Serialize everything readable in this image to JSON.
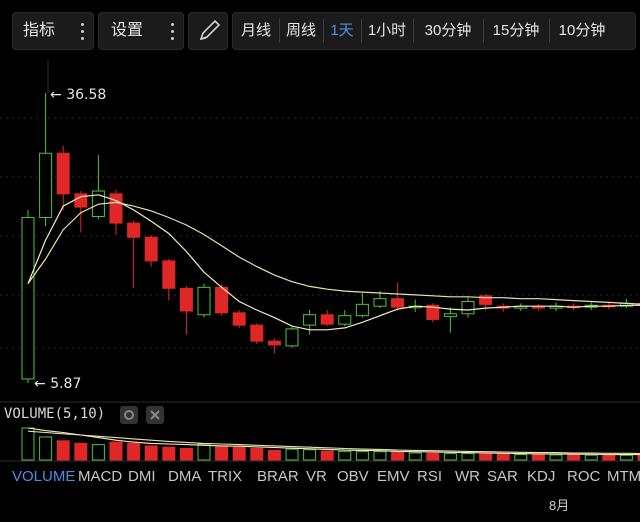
{
  "toolbar": {
    "indicator_label": "指标",
    "settings_label": "设置",
    "periods": [
      {
        "label": "月线",
        "active": false
      },
      {
        "label": "周线",
        "active": false
      },
      {
        "label": "1天",
        "active": true
      },
      {
        "label": "1小时",
        "active": false
      },
      {
        "label": "30分钟",
        "active": false
      },
      {
        "label": "15分钟",
        "active": false
      },
      {
        "label": "10分钟",
        "active": false
      }
    ]
  },
  "chart": {
    "high_label": "36.58",
    "low_label": "5.87",
    "high_value": 36.58,
    "low_value": 5.87,
    "up_color": "#4ec33c",
    "down_color": "#e02727",
    "ma_color": "#f2f0c0"
  },
  "chart_data": {
    "type": "candlestick",
    "candles": [
      {
        "o": 6.3,
        "c": 23.4,
        "h": 24.2,
        "l": 5.87
      },
      {
        "o": 23.4,
        "c": 30.2,
        "h": 36.58,
        "l": 22.5
      },
      {
        "o": 30.2,
        "c": 25.9,
        "h": 31.0,
        "l": 24.2
      },
      {
        "o": 25.9,
        "c": 24.5,
        "h": 26.2,
        "l": 21.8
      },
      {
        "o": 23.5,
        "c": 26.2,
        "h": 30.0,
        "l": 23.2
      },
      {
        "o": 25.9,
        "c": 22.8,
        "h": 26.3,
        "l": 21.6
      },
      {
        "o": 22.8,
        "c": 21.3,
        "h": 23.1,
        "l": 15.9
      },
      {
        "o": 21.3,
        "c": 18.8,
        "h": 21.5,
        "l": 18.2
      },
      {
        "o": 18.8,
        "c": 15.9,
        "h": 19.0,
        "l": 14.6
      },
      {
        "o": 15.9,
        "c": 13.5,
        "h": 16.1,
        "l": 11.0
      },
      {
        "o": 13.1,
        "c": 16.0,
        "h": 16.4,
        "l": 12.8
      },
      {
        "o": 16.0,
        "c": 13.3,
        "h": 16.3,
        "l": 13.0
      },
      {
        "o": 13.3,
        "c": 12.0,
        "h": 13.6,
        "l": 11.7
      },
      {
        "o": 12.0,
        "c": 10.3,
        "h": 12.2,
        "l": 10.0
      },
      {
        "o": 10.3,
        "c": 9.9,
        "h": 10.6,
        "l": 9.0
      },
      {
        "o": 9.8,
        "c": 11.6,
        "h": 11.8,
        "l": 9.6
      },
      {
        "o": 12.0,
        "c": 13.1,
        "h": 13.6,
        "l": 11.0
      },
      {
        "o": 13.1,
        "c": 12.1,
        "h": 13.6,
        "l": 11.9
      },
      {
        "o": 12.1,
        "c": 13.0,
        "h": 13.6,
        "l": 11.9
      },
      {
        "o": 13.0,
        "c": 14.2,
        "h": 15.4,
        "l": 12.8
      },
      {
        "o": 14.0,
        "c": 14.8,
        "h": 15.6,
        "l": 13.8
      },
      {
        "o": 14.8,
        "c": 13.9,
        "h": 16.5,
        "l": 13.5
      },
      {
        "o": 13.9,
        "c": 14.0,
        "h": 14.7,
        "l": 13.4
      },
      {
        "o": 14.1,
        "c": 12.6,
        "h": 14.3,
        "l": 12.3
      },
      {
        "o": 12.9,
        "c": 13.2,
        "h": 13.9,
        "l": 11.2
      },
      {
        "o": 13.2,
        "c": 14.5,
        "h": 14.9,
        "l": 12.8
      },
      {
        "o": 15.1,
        "c": 14.2,
        "h": 15.3,
        "l": 13.6
      },
      {
        "o": 14.0,
        "c": 13.8,
        "h": 14.3,
        "l": 13.4
      },
      {
        "o": 13.8,
        "c": 14.0,
        "h": 14.3,
        "l": 13.5
      },
      {
        "o": 14.0,
        "c": 13.8,
        "h": 14.2,
        "l": 13.5
      },
      {
        "o": 13.8,
        "c": 14.0,
        "h": 14.4,
        "l": 13.5
      },
      {
        "o": 14.0,
        "c": 13.9,
        "h": 14.3,
        "l": 13.6
      },
      {
        "o": 13.9,
        "c": 14.1,
        "h": 14.4,
        "l": 13.6
      },
      {
        "o": 14.1,
        "c": 14.0,
        "h": 14.5,
        "l": 13.7
      },
      {
        "o": 14.0,
        "c": 14.3,
        "h": 14.8,
        "l": 13.8
      },
      {
        "o": 14.3,
        "c": 14.1,
        "h": 14.7,
        "l": 13.9
      }
    ],
    "ma_fast": [
      16.4,
      21.0,
      24.6,
      25.6,
      25.8,
      25.2,
      24.2,
      23.0,
      21.7,
      19.8,
      17.6,
      16.0,
      14.5,
      13.6,
      12.8,
      11.9,
      11.5,
      11.5,
      11.7,
      12.3,
      13.0,
      13.7,
      14.0,
      13.9,
      13.7,
      13.6,
      13.8,
      13.9,
      14.0,
      14.0,
      14.0,
      13.9,
      14.0,
      14.0,
      14.1,
      14.1
    ],
    "ma_slow": [
      16.4,
      19.0,
      22.1,
      23.9,
      24.8,
      25.0,
      24.6,
      24.1,
      23.4,
      22.6,
      21.6,
      20.4,
      19.2,
      18.2,
      17.3,
      16.6,
      16.1,
      15.8,
      15.6,
      15.5,
      15.4,
      15.3,
      15.2,
      15.1,
      15.0,
      15.0,
      14.9,
      14.9,
      14.8,
      14.8,
      14.7,
      14.6,
      14.5,
      14.4,
      14.3,
      14.2
    ],
    "volumes": [
      100,
      72,
      60,
      52,
      48,
      56,
      52,
      44,
      40,
      36,
      50,
      44,
      40,
      36,
      30,
      34,
      32,
      28,
      27,
      26,
      26,
      24,
      22,
      21,
      20,
      20,
      19,
      18,
      17,
      17,
      16,
      16,
      15,
      15,
      15,
      15
    ],
    "vol_ma5": [
      100,
      92,
      86,
      78,
      70,
      62,
      56,
      52,
      50,
      48,
      46,
      44,
      43,
      41,
      39,
      37,
      35,
      33,
      31,
      30,
      29,
      27,
      26,
      25,
      24,
      23,
      22,
      21,
      20,
      19,
      19,
      18,
      18,
      17,
      17,
      17
    ],
    "vol_ma10": [
      90,
      86,
      82,
      78,
      74,
      70,
      66,
      62,
      58,
      55,
      52,
      50,
      48,
      46,
      44,
      42,
      40,
      38,
      36,
      34,
      33,
      31,
      30,
      29,
      28,
      27,
      26,
      25,
      24,
      23,
      23,
      22,
      22,
      21,
      21,
      20
    ]
  },
  "volume": {
    "label": "VOLUME(5,10)"
  },
  "indicators": [
    {
      "label": "VOLUME",
      "active": true
    },
    {
      "label": "MACD",
      "active": false
    },
    {
      "label": "DMI",
      "active": false
    },
    {
      "label": "DMA",
      "active": false
    },
    {
      "label": "TRIX",
      "active": false
    },
    {
      "label": "BRAR",
      "active": false
    },
    {
      "label": "VR",
      "active": false
    },
    {
      "label": "OBV",
      "active": false
    },
    {
      "label": "EMV",
      "active": false
    },
    {
      "label": "RSI",
      "active": false
    },
    {
      "label": "WR",
      "active": false
    },
    {
      "label": "SAR",
      "active": false
    },
    {
      "label": "KDJ",
      "active": false
    },
    {
      "label": "ROC",
      "active": false
    },
    {
      "label": "MTM",
      "active": false
    }
  ],
  "x_axis": {
    "date_label": "8月"
  }
}
